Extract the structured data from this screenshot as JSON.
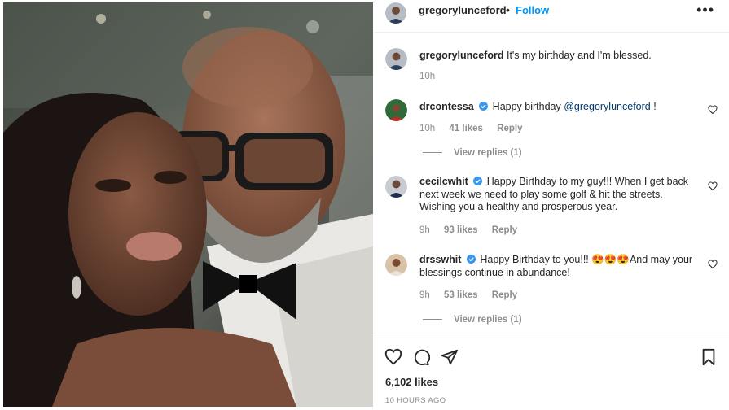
{
  "post": {
    "author": "gregorylunceford",
    "follow_label": "Follow",
    "dot": "•",
    "more": "•••"
  },
  "caption": {
    "username": "gregorylunceford",
    "text": " It's my birthday and I'm blessed.",
    "time": "10h"
  },
  "comments": [
    {
      "username": "drcontessa",
      "text_before": "Happy birthday ",
      "mention": "@gregorylunceford",
      "text_after": " !",
      "time": "10h",
      "likes": "41 likes",
      "reply": "Reply",
      "view_replies": "View replies (1)"
    },
    {
      "username": "cecilcwhit",
      "text": "Happy Birthday to my guy!!! When I get back next week we need to play some golf & hit the streets. Wishing you a healthy and prosperous year.",
      "time": "9h",
      "likes": "93 likes",
      "reply": "Reply"
    },
    {
      "username": "drsswhit",
      "text_before": "Happy Birthday to you!!! ",
      "emoji": "😍😍😍",
      "text_after": "And may your blessings continue in abundance!",
      "time": "9h",
      "likes": "53 likes",
      "reply": "Reply",
      "view_replies": "View replies (1)"
    }
  ],
  "footer": {
    "likes": "6,102 likes",
    "timestamp": "10 HOURS AGO"
  },
  "colors": {
    "accent": "#0095f6",
    "verified": "#3897f0",
    "muted": "#8e8e8e",
    "text": "#262626"
  }
}
